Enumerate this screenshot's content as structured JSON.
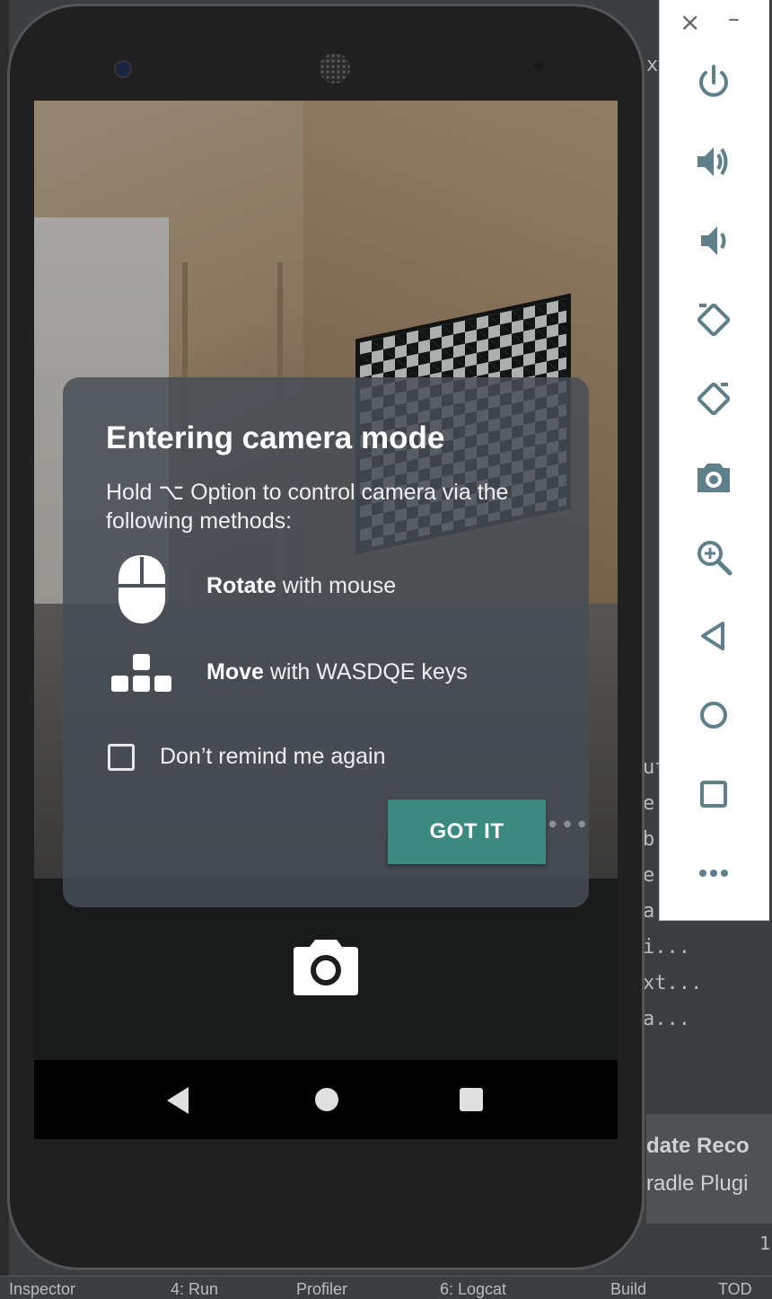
{
  "dialog": {
    "title": "Entering camera mode",
    "body": "Hold ⌥ Option to control camera via the following methods:",
    "methods": [
      {
        "bold": "Rotate",
        "rest": " with mouse",
        "icon": "mouse-icon"
      },
      {
        "bold": "Move",
        "rest": " with WASDQE keys",
        "icon": "keyboard-keys-icon"
      }
    ],
    "checkbox_label": "Don’t remind me again",
    "button_label": "GOT IT"
  },
  "toolbar": {
    "close_label": "×",
    "minimize_label": "–",
    "buttons": [
      {
        "name": "power-icon"
      },
      {
        "name": "volume-up-icon"
      },
      {
        "name": "volume-down-icon"
      },
      {
        "name": "rotate-left-icon"
      },
      {
        "name": "rotate-right-icon"
      },
      {
        "name": "screenshot-icon"
      },
      {
        "name": "zoom-icon"
      },
      {
        "name": "back-icon"
      },
      {
        "name": "home-icon"
      },
      {
        "name": "overview-icon"
      },
      {
        "name": "more-icon"
      }
    ]
  },
  "ide": {
    "right_fragments": [
      "ut",
      "e",
      "b",
      "e",
      "a",
      "i...",
      "xt...",
      "a..."
    ],
    "banner_line1": "date Reco",
    "banner_line2": "radle Plugi",
    "status_items": [
      "Inspector",
      "4: Run",
      "Profiler",
      "6: Logcat",
      "Build",
      "TOD"
    ],
    "page_num": "1",
    "x_char": "x"
  },
  "colors": {
    "accent": "#3b8a80",
    "dialog_bg": "#464e56",
    "toolbar_icon": "#5f7f8a"
  }
}
